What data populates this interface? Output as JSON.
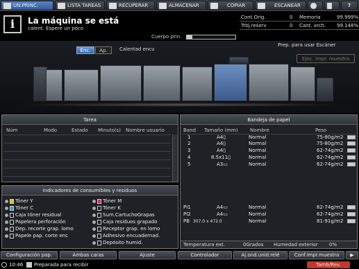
{
  "tabs": [
    {
      "label": "UN.PRINC.",
      "active": true
    },
    {
      "label": "LISTA TAREAS"
    },
    {
      "label": "RECUPERAR"
    },
    {
      "label": "ALMACENAR"
    },
    {
      "label": "COPIAR"
    },
    {
      "label": "ESCANEAR"
    },
    {
      "label": "?"
    }
  ],
  "message": {
    "title": "La máquina se está",
    "subtitle": "calent. Espere un poco"
  },
  "cuerpo_label": "Cuerpo prin.",
  "toner_level": 0.12,
  "counters": {
    "cont_orig_label": "Cont.Orig.",
    "cont_orig_value": "0",
    "memoria_label": "Memoria",
    "memoria_value": "99.999%",
    "trbj_label": "Trbj.reserv",
    "trbj_value": "0",
    "cant_arch_label": "Cant. arch.",
    "cant_arch_value": "99.148%"
  },
  "prep_text": "Prep. para usar Escáner",
  "ejec_label": "Ejec. impr. muestra",
  "mode_buttons": {
    "enc": "Enc.",
    "ap": "Ap."
  },
  "calent_text": "Calentad encu",
  "tarea": {
    "title": "Tarea",
    "columns": [
      "Núm",
      "Modo",
      "Estado",
      "Minuto(s)",
      "Nombre usuario"
    ]
  },
  "consumibles": {
    "title": "Indicadores de consumibles y residuos",
    "left": [
      "Tóner Y",
      "Tóner C",
      "Caja tóner residual",
      "Papelera perforación",
      "Dep. recorte grap. lomo",
      "Papele pap. corte enc"
    ],
    "right": [
      "Tóner M",
      "Tóner K",
      "Sum.CartuchoGrapas",
      "Caja residuos grapado",
      "Receptor grap. en lomo",
      "Adhesivo encuadernad.",
      "Depósito humid."
    ]
  },
  "bandeja": {
    "title": "Bandeja de papel",
    "columns": [
      "Band",
      "Tamaño (mm)",
      "Nombre",
      "Peso"
    ],
    "rows": [
      {
        "band": "1",
        "size": "A4▯",
        "name": "Normal",
        "peso": "75-80g/m2"
      },
      {
        "band": "2",
        "size": "A4▯",
        "name": "Normal",
        "peso": "75-80g/m2"
      },
      {
        "band": "3",
        "size": "A4▯",
        "name": "Normal",
        "peso": "62-74g/m2"
      },
      {
        "band": "4",
        "size": "8.5x11▯",
        "name": "Normal",
        "peso": "62-74g/m2"
      },
      {
        "band": "5",
        "size": "A3▭",
        "name": "Normal",
        "peso": "62-74g/m2"
      }
    ],
    "rows_bottom": [
      {
        "band": "PI1",
        "size": "A4▭",
        "name": "Normal",
        "peso": "62-74g/m2"
      },
      {
        "band": "PI2",
        "size": "A4▭",
        "name": "Normal",
        "peso": "62-74g/m2"
      },
      {
        "band": "PB",
        "size": "307.0 x 472.0",
        "name": "Normal",
        "peso": "81-91g/m2"
      }
    ],
    "temp_label": "Temperatura ext.",
    "temp_value": "0Grados",
    "hum_label": "Humedad exterior",
    "hum_value": "0%"
  },
  "bottom_buttons": [
    "Configuración pap.",
    "Ambas caras",
    "Ajuste",
    "Controlador",
    "Aj.ond.unid.relé",
    "Conf.impr.muestra"
  ],
  "status": {
    "time": "10:46",
    "text": "Preparada para recibir",
    "badge": "Tamb/Rev."
  },
  "colors": {
    "accent": "#3060a8",
    "badge": "#c0392b"
  }
}
